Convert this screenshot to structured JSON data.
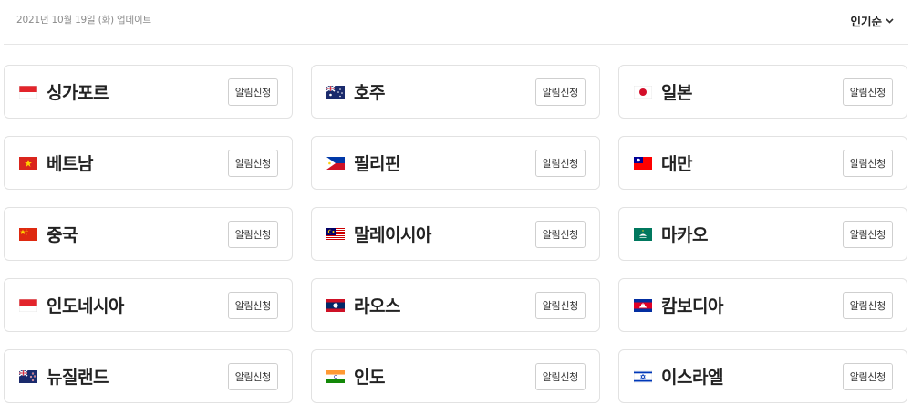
{
  "header": {
    "update_text": "2021년 10월 19일 (화) 업데이트",
    "sort_label": "인기순"
  },
  "countries": [
    {
      "name": "싱가포르",
      "flag": "sg-flag-icon"
    },
    {
      "name": "호주",
      "flag": "au-flag-icon"
    },
    {
      "name": "일본",
      "flag": "jp-flag-icon"
    },
    {
      "name": "베트남",
      "flag": "vn-flag-icon"
    },
    {
      "name": "필리핀",
      "flag": "ph-flag-icon"
    },
    {
      "name": "대만",
      "flag": "tw-flag-icon"
    },
    {
      "name": "중국",
      "flag": "cn-flag-icon"
    },
    {
      "name": "말레이시아",
      "flag": "my-flag-icon"
    },
    {
      "name": "마카오",
      "flag": "mo-flag-icon"
    },
    {
      "name": "인도네시아",
      "flag": "id-flag-icon"
    },
    {
      "name": "라오스",
      "flag": "la-flag-icon"
    },
    {
      "name": "캄보디아",
      "flag": "kh-flag-icon"
    },
    {
      "name": "뉴질랜드",
      "flag": "nz-flag-icon"
    },
    {
      "name": "인도",
      "flag": "in-flag-icon"
    },
    {
      "name": "이스라엘",
      "flag": "il-flag-icon"
    }
  ],
  "alarm_label": "알림신청"
}
